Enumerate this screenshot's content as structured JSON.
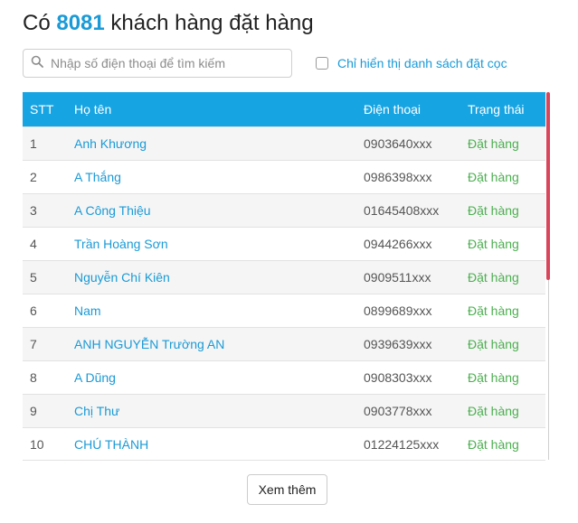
{
  "header": {
    "prefix": "Có",
    "count": "8081",
    "suffix": "khách hàng đặt hàng"
  },
  "search": {
    "placeholder": "Nhập số điện thoại để tìm kiếm",
    "value": "",
    "icon": "search-icon"
  },
  "filter": {
    "label": "Chỉ hiển thị danh sách đặt cọc",
    "checked": false
  },
  "table": {
    "columns": [
      "STT",
      "Họ tên",
      "Điện thoại",
      "Trạng thái"
    ],
    "rows": [
      {
        "stt": "1",
        "name": "Anh Khương",
        "phone": "0903640xxx",
        "status": "Đặt hàng"
      },
      {
        "stt": "2",
        "name": "A Thắng",
        "phone": "0986398xxx",
        "status": "Đặt hàng"
      },
      {
        "stt": "3",
        "name": "A Công Thiệu",
        "phone": "01645408xxx",
        "status": "Đặt hàng"
      },
      {
        "stt": "4",
        "name": "Trần Hoàng Sơn",
        "phone": "0944266xxx",
        "status": "Đặt hàng"
      },
      {
        "stt": "5",
        "name": "Nguyễn Chí Kiên",
        "phone": "0909511xxx",
        "status": "Đặt hàng"
      },
      {
        "stt": "6",
        "name": "Nam",
        "phone": "0899689xxx",
        "status": "Đặt hàng"
      },
      {
        "stt": "7",
        "name": "ANH NGUYỄN Trường AN",
        "phone": "0939639xxx",
        "status": "Đặt hàng"
      },
      {
        "stt": "8",
        "name": "A Dũng",
        "phone": "0908303xxx",
        "status": "Đặt hàng"
      },
      {
        "stt": "9",
        "name": "Chị Thư",
        "phone": "0903778xxx",
        "status": "Đặt hàng"
      },
      {
        "stt": "10",
        "name": "CHÚ THÀNH",
        "phone": "01224125xxx",
        "status": "Đặt hàng"
      }
    ]
  },
  "more_button": {
    "label": "Xem thêm"
  },
  "colors": {
    "accent": "#1a9ad6",
    "header_bg": "#17a4e2",
    "status": "#4caf50",
    "scrollbar": "#d9455a"
  }
}
